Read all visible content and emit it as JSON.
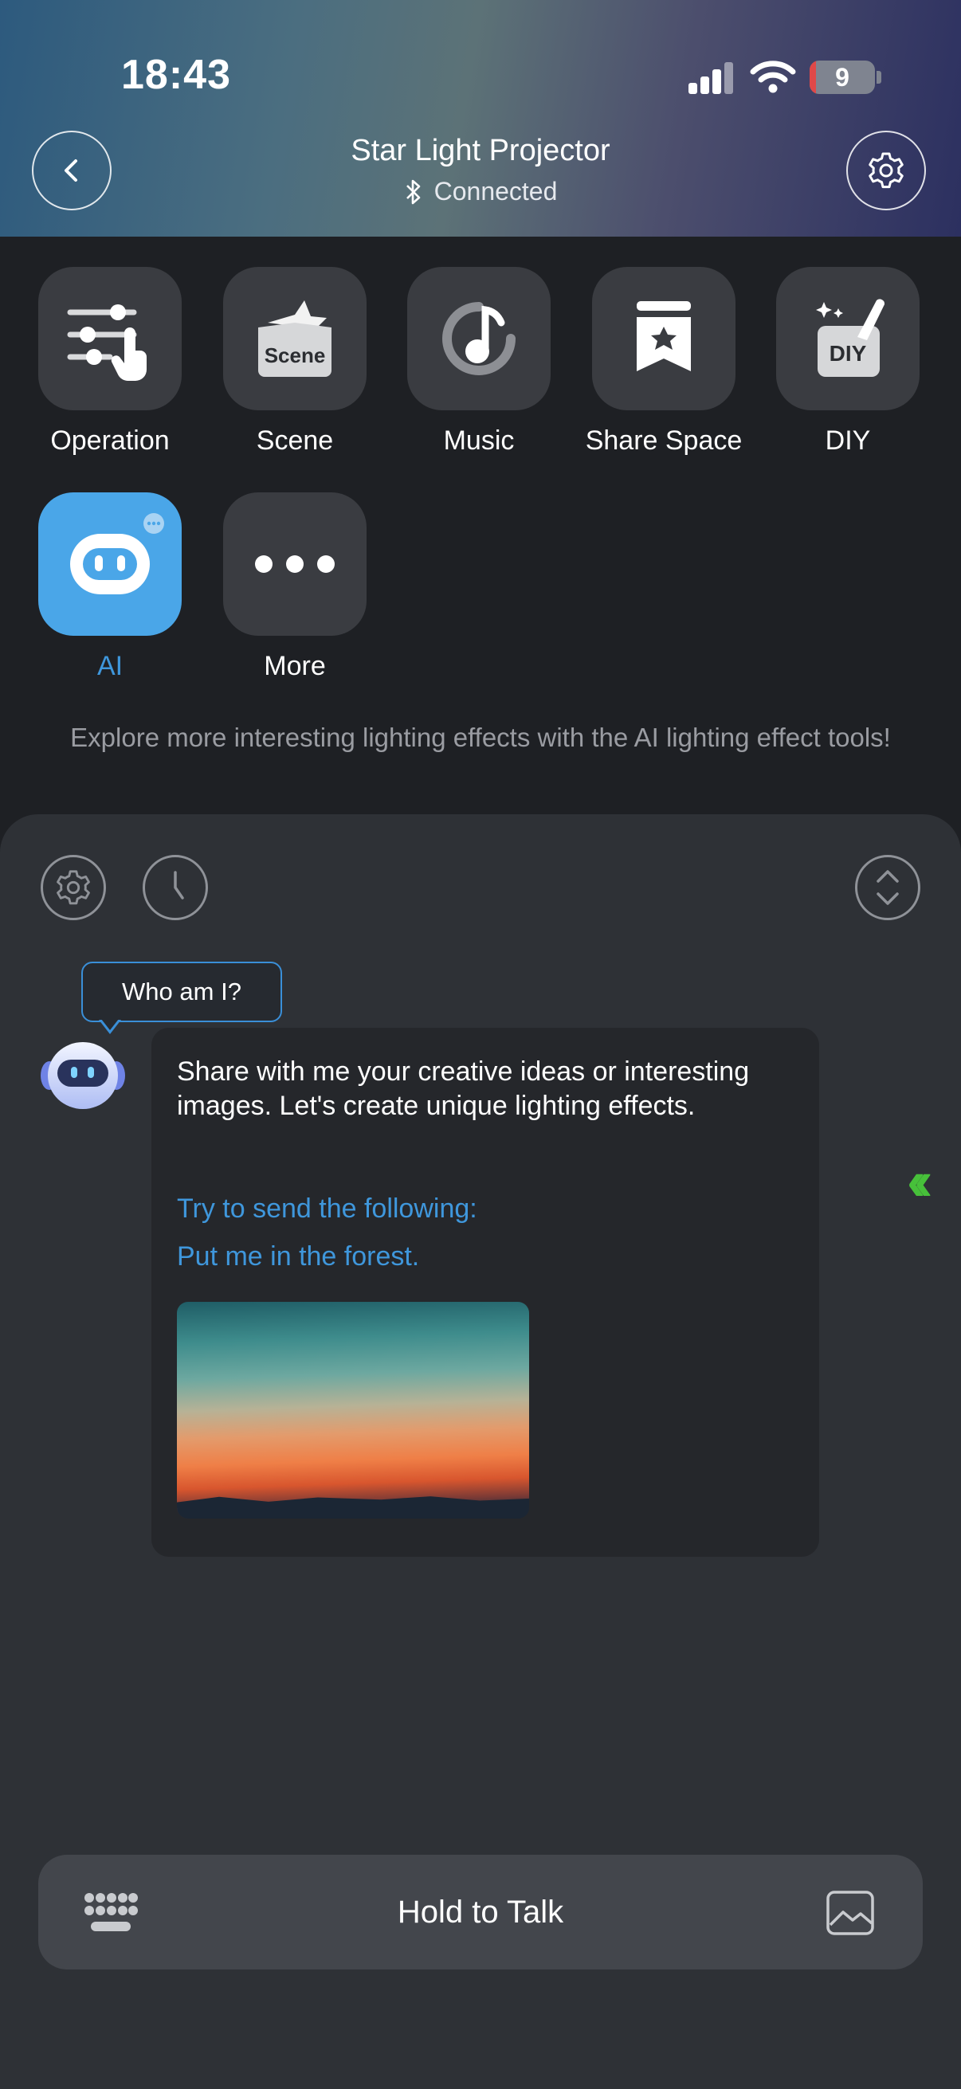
{
  "status_bar": {
    "time": "18:43",
    "battery": "9",
    "battery_level": 0.09
  },
  "header": {
    "title": "Star Light Projector",
    "status": "Connected"
  },
  "features": [
    {
      "label": "Operation",
      "icon": "sliders-hand-icon"
    },
    {
      "label": "Scene",
      "icon": "scene-icon",
      "icon_text": "Scene"
    },
    {
      "label": "Music",
      "icon": "music-note-icon"
    },
    {
      "label": "Share Space",
      "icon": "share-space-icon"
    },
    {
      "label": "DIY",
      "icon": "diy-brush-icon",
      "icon_text": "DIY"
    },
    {
      "label": "AI",
      "icon": "ai-robot-icon",
      "selected": true
    },
    {
      "label": "More",
      "icon": "more-dots-icon"
    }
  ],
  "promo_text": "Explore more interesting lighting effects with the AI lighting effect tools!",
  "chat": {
    "who_am_i": "Who am I?",
    "message": "Share with me your creative ideas or interesting images. Let's create unique lighting effects.",
    "try_label": "Try to send the following:",
    "example": "Put me in the forest."
  },
  "input": {
    "talk_label": "Hold to Talk"
  },
  "colors": {
    "accent": "#3f97dc",
    "ai_tile": "#4aa6e8",
    "collapse_arrows": "#47c03a",
    "battery_low": "#e04848"
  }
}
